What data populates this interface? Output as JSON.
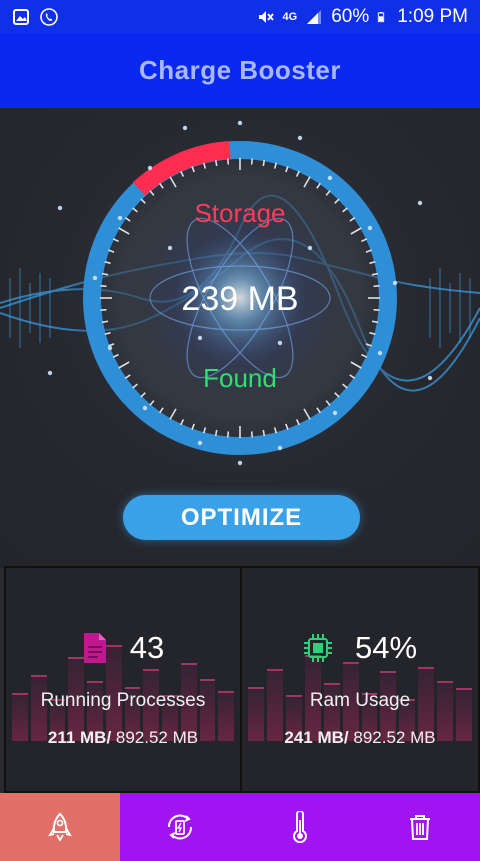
{
  "status_bar": {
    "network": "4G",
    "battery": "60%",
    "time": "1:09 PM"
  },
  "app_bar": {
    "title": "Charge Booster"
  },
  "gauge": {
    "label_top": "Storage",
    "value": "239 MB",
    "label_bottom": "Found"
  },
  "optimize_button": {
    "label": "OPTIMIZE"
  },
  "stats": {
    "processes": {
      "count": "43",
      "label": "Running Processes",
      "used": "211 MB/",
      "total": " 892.52 MB"
    },
    "ram": {
      "percent": "54%",
      "label": "Ram Usage",
      "used": "241 MB/",
      "total": " 892.52 MB"
    }
  },
  "colors": {
    "app_bar": "#0a29f0",
    "accent_blue": "#3aa0e8",
    "nav_bar": "#a014f2",
    "nav_active": "#e07068",
    "storage_red": "#ff3b5c",
    "found_green": "#2ee06e"
  },
  "nav": {
    "items": [
      {
        "icon": "rocket-icon",
        "active": true
      },
      {
        "icon": "battery-charge-icon",
        "active": false
      },
      {
        "icon": "thermometer-icon",
        "active": false
      },
      {
        "icon": "trash-icon",
        "active": false
      }
    ]
  }
}
